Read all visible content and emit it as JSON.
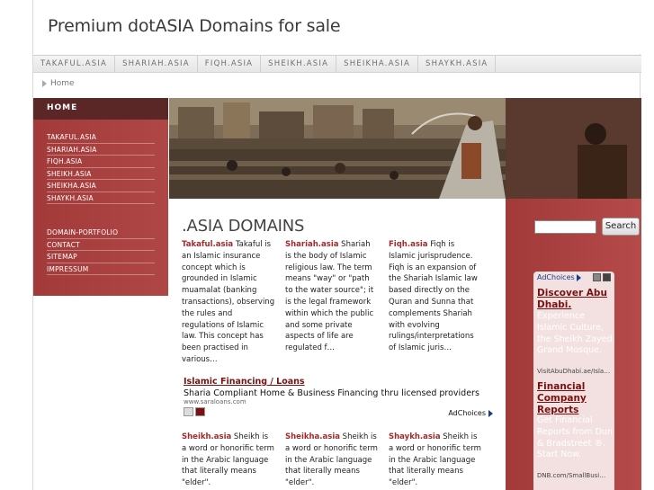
{
  "header": {
    "title": "Premium dotASIA Domains for sale"
  },
  "topnav": [
    "TAKAFUL.ASIA",
    "SHARIAH.ASIA",
    "FIQH.ASIA",
    "SHEIKH.ASIA",
    "SHEIKHA.ASIA",
    "SHAYKH.ASIA"
  ],
  "breadcrumb": {
    "home": "Home"
  },
  "sidebar": {
    "home": "HOME",
    "group1": [
      "TAKAFUL.ASIA",
      "SHARIAH.ASIA",
      "FIQH.ASIA",
      "SHEIKH.ASIA",
      "SHEIKHA.ASIA",
      "SHAYKH.ASIA"
    ],
    "group2": [
      "DOMAIN-PORTFOLIO",
      "CONTACT",
      "SITEMAP",
      "IMPRESSUM"
    ]
  },
  "main": {
    "heading": ".ASIA DOMAINS",
    "row1": [
      {
        "name": "Takaful.asia",
        "text": " Takaful is an Islamic insurance concept which is grounded in Islamic muamalat (banking transactions), observing the rules and regulations of Islamic law. This concept has been practised in various…"
      },
      {
        "name": "Shariah.asia",
        "text": " Shariah is the body of Islamic religious law. The term means \"way\" or \"path to the water source\"; it is the legal framework within which the public and some private aspects of life are regulated f…"
      },
      {
        "name": "Fiqh.asia",
        "text": " Fiqh is Islamic jurisprudence. Fiqh is an expansion of the Shariah Islamic law based directly on the Quran and Sunna that complements Shariah with evolving rulings/interpretations of Islamic juris…"
      }
    ],
    "ad": {
      "title": "Islamic Financing / Loans",
      "desc": "Sharia Compliant Home & Business Financing thru licensed providers",
      "url": "www.saraloans.com",
      "adchoices": "AdChoices"
    },
    "row2": [
      {
        "name": "Sheikh.asia",
        "text": " Sheikh is a word or honorific term in the Arabic language that literally means \"elder\"."
      },
      {
        "name": "Sheikha.asia",
        "text": " Sheikh is a word or honorific term in the Arabic language that literally means \"elder\"."
      },
      {
        "name": "Shaykh.asia",
        "text": " Sheikh is a word or honorific term in the Arabic language that literally means \"elder\"."
      }
    ]
  },
  "search": {
    "button": "Search",
    "placeholder": ""
  },
  "side_ad": {
    "adchoices": "AdChoices",
    "ad1_title": "Discover Abu Dhabi.",
    "ad1_desc": "Experience Islamic Culture, the Sheikh Zayed Grand Mosque.",
    "ad1_url": "VisitAbuDhabi.ae/Isla…",
    "ad2_title": "Financial Company Reports",
    "ad2_desc": "Get Financial Reports from Dun & Bradstreet ®. Start Now.",
    "ad2_url": "DNB.com/SmallBusi…"
  },
  "colors": {
    "accent": "#a23a3a",
    "dark_accent": "#5a2626",
    "link": "#7a1111"
  }
}
